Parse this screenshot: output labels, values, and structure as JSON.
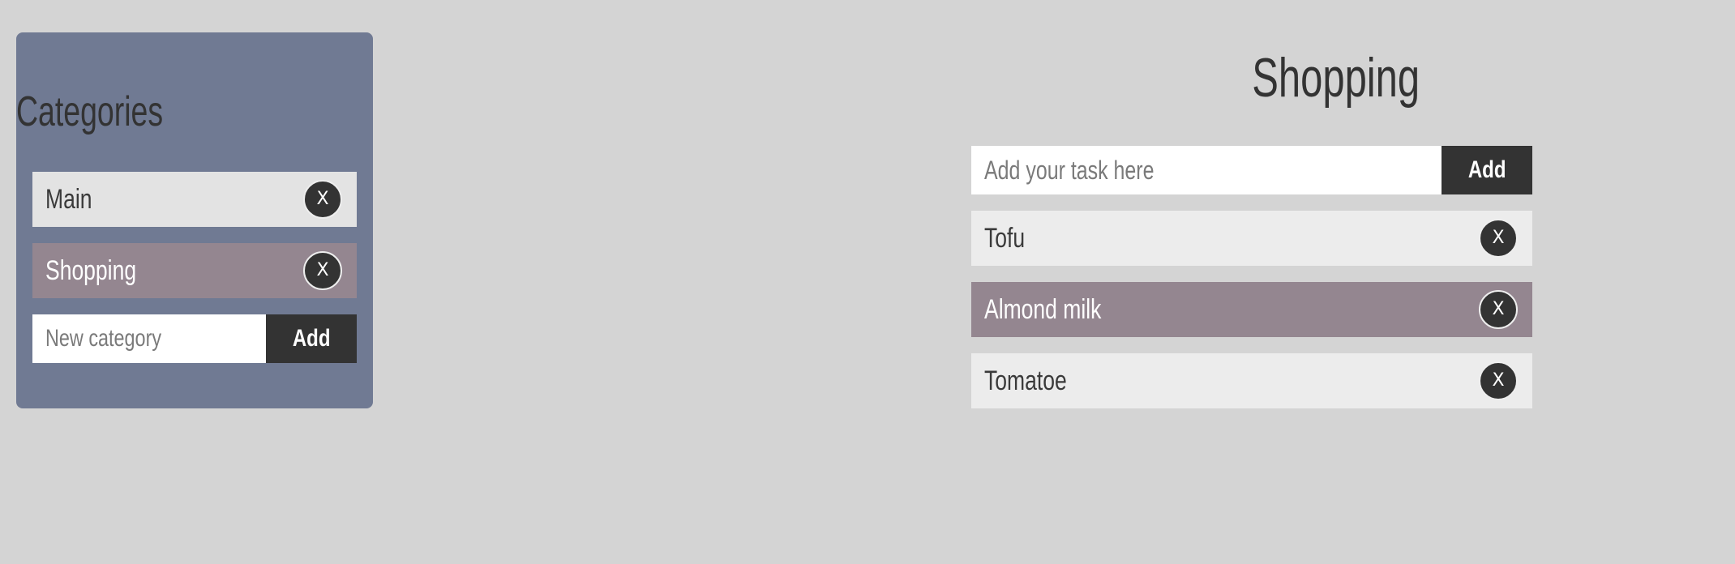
{
  "sidebar": {
    "title": "Categories",
    "items": [
      {
        "label": "Main",
        "selected": false,
        "delete_label": "X"
      },
      {
        "label": "Shopping",
        "selected": true,
        "delete_label": "X"
      }
    ],
    "new_category": {
      "placeholder": "New category",
      "value": "",
      "add_label": "Add"
    }
  },
  "main": {
    "title": "Shopping",
    "new_task": {
      "placeholder": "Add your task here",
      "value": "",
      "add_label": "Add"
    },
    "tasks": [
      {
        "label": "Tofu",
        "selected": false,
        "delete_label": "X"
      },
      {
        "label": "Almond milk",
        "selected": true,
        "delete_label": "X"
      },
      {
        "label": "Tomatoe",
        "selected": false,
        "delete_label": "X"
      }
    ]
  },
  "colors": {
    "background": "#d4d4d4",
    "sidebar": "#707a93",
    "selected_item": "#948690",
    "item": "#ececec",
    "button": "#333333"
  }
}
